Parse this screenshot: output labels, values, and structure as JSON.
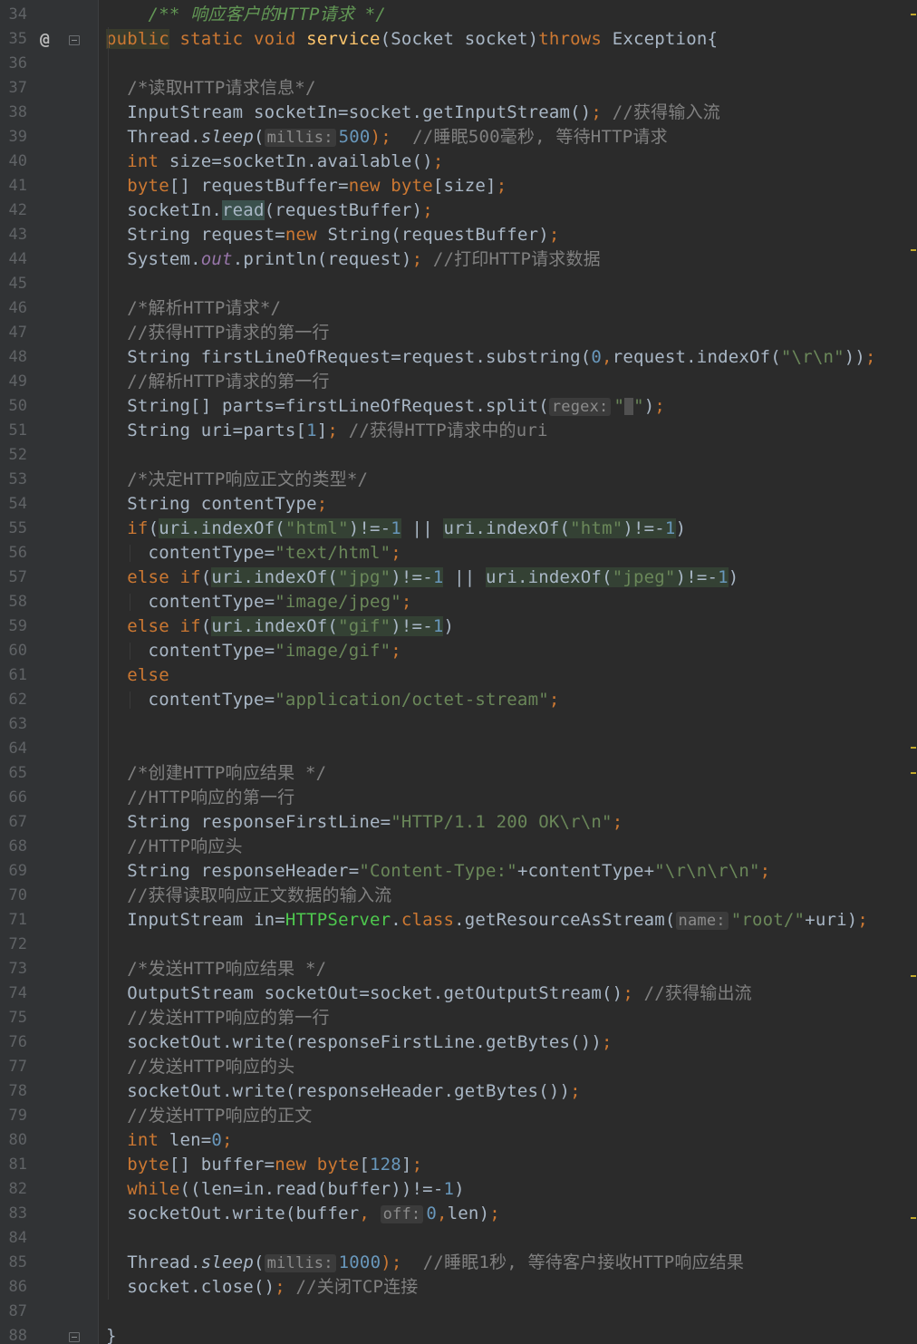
{
  "editor": {
    "gutter_marker": "@",
    "lines": [
      {
        "n": "34",
        "tokens": [
          {
            "t": "    /** ",
            "c": "doc"
          },
          {
            "t": "响应客户的HTTP请求 */",
            "c": "doc"
          }
        ]
      },
      {
        "n": "35",
        "marker": true,
        "fold": true,
        "tokens": [
          {
            "t": "public",
            "c": "kw hl2"
          },
          {
            "t": " static void ",
            "c": "kw"
          },
          {
            "t": "service",
            "c": "fn"
          },
          {
            "t": "(Socket socket)",
            "c": ""
          },
          {
            "t": "throws ",
            "c": "kw"
          },
          {
            "t": "Exception{",
            "c": ""
          }
        ]
      },
      {
        "n": "36",
        "tokens": []
      },
      {
        "n": "37",
        "tokens": [
          {
            "t": "  /*读取HTTP请求信息*/",
            "c": "cm"
          }
        ]
      },
      {
        "n": "38",
        "tokens": [
          {
            "t": "  InputStream socketIn=socket.getInputStream()",
            "c": ""
          },
          {
            "t": "; ",
            "c": "kw"
          },
          {
            "t": "//获得输入流",
            "c": "cm"
          }
        ]
      },
      {
        "n": "39",
        "tokens": [
          {
            "t": "  Thread.",
            "c": ""
          },
          {
            "t": "sleep",
            "c": "ital"
          },
          {
            "t": "(",
            "c": ""
          },
          {
            "t": "millis:",
            "c": "hint"
          },
          {
            "t": "500",
            "c": "num"
          },
          {
            "t": ");",
            "c": "kw"
          },
          {
            "t": "  //睡眠500毫秒, 等待HTTP请求",
            "c": "cm"
          }
        ]
      },
      {
        "n": "40",
        "tokens": [
          {
            "t": "  ",
            "c": ""
          },
          {
            "t": "int ",
            "c": "kw"
          },
          {
            "t": "size=socketIn.available()",
            "c": ""
          },
          {
            "t": ";",
            "c": "kw"
          }
        ]
      },
      {
        "n": "41",
        "tokens": [
          {
            "t": "  ",
            "c": ""
          },
          {
            "t": "byte",
            "c": "kw"
          },
          {
            "t": "[] requestBuffer=",
            "c": ""
          },
          {
            "t": "new ",
            "c": "kw"
          },
          {
            "t": "byte",
            "c": "kw"
          },
          {
            "t": "[size]",
            "c": ""
          },
          {
            "t": ";",
            "c": "kw"
          }
        ]
      },
      {
        "n": "42",
        "tokens": [
          {
            "t": "  socketIn.",
            "c": ""
          },
          {
            "t": "read",
            "c": "read-hl"
          },
          {
            "t": "(requestBuffer)",
            "c": ""
          },
          {
            "t": ";",
            "c": "kw"
          }
        ]
      },
      {
        "n": "43",
        "tokens": [
          {
            "t": "  String request=",
            "c": ""
          },
          {
            "t": "new ",
            "c": "kw"
          },
          {
            "t": "String(requestBuffer)",
            "c": ""
          },
          {
            "t": ";",
            "c": "kw"
          }
        ]
      },
      {
        "n": "44",
        "tokens": [
          {
            "t": "  System.",
            "c": ""
          },
          {
            "t": "out",
            "c": "fld"
          },
          {
            "t": ".println(request)",
            "c": ""
          },
          {
            "t": "; ",
            "c": "kw"
          },
          {
            "t": "//打印HTTP请求数据",
            "c": "cm"
          }
        ]
      },
      {
        "n": "45",
        "tokens": []
      },
      {
        "n": "46",
        "tokens": [
          {
            "t": "  /*解析HTTP请求*/",
            "c": "cm"
          }
        ]
      },
      {
        "n": "47",
        "tokens": [
          {
            "t": "  //获得HTTP请求的第一行",
            "c": "cm"
          }
        ]
      },
      {
        "n": "48",
        "tokens": [
          {
            "t": "  String firstLineOfRequest=request.substring(",
            "c": ""
          },
          {
            "t": "0",
            "c": "num"
          },
          {
            "t": ",",
            "c": "kw"
          },
          {
            "t": "request.indexOf(",
            "c": ""
          },
          {
            "t": "\"\\r\\n\"",
            "c": "str"
          },
          {
            "t": "))",
            "c": ""
          },
          {
            "t": ";",
            "c": "kw"
          }
        ]
      },
      {
        "n": "49",
        "tokens": [
          {
            "t": "  //解析HTTP请求的第一行",
            "c": "cm"
          }
        ]
      },
      {
        "n": "50",
        "tokens": [
          {
            "t": "  String[] parts=firstLineOfRequest.split(",
            "c": ""
          },
          {
            "t": "regex:",
            "c": "hint"
          },
          {
            "t": "\"",
            "c": "str"
          },
          {
            "t": "CARET",
            "c": "caret"
          },
          {
            "t": "\"",
            "c": "str"
          },
          {
            "t": ")",
            "c": ""
          },
          {
            "t": ";",
            "c": "kw"
          }
        ]
      },
      {
        "n": "51",
        "tokens": [
          {
            "t": "  String uri=parts[",
            "c": ""
          },
          {
            "t": "1",
            "c": "num"
          },
          {
            "t": "]",
            "c": ""
          },
          {
            "t": "; ",
            "c": "kw"
          },
          {
            "t": "//获得HTTP请求中的uri",
            "c": "cm"
          }
        ]
      },
      {
        "n": "52",
        "tokens": []
      },
      {
        "n": "53",
        "tokens": [
          {
            "t": "  /*决定HTTP响应正文的类型*/",
            "c": "cm"
          }
        ]
      },
      {
        "n": "54",
        "tokens": [
          {
            "t": "  String contentType",
            "c": ""
          },
          {
            "t": ";",
            "c": "kw"
          }
        ]
      },
      {
        "n": "55",
        "tokens": [
          {
            "t": "  ",
            "c": ""
          },
          {
            "t": "if",
            "c": "kw"
          },
          {
            "t": "(",
            "c": ""
          },
          {
            "t": "uri.indexOf(",
            "c": "hl"
          },
          {
            "t": "\"html\"",
            "c": "str hl"
          },
          {
            "t": ")!=-",
            "c": "hl"
          },
          {
            "t": "1",
            "c": "num hl"
          },
          {
            "t": " || ",
            "c": ""
          },
          {
            "t": "uri.indexOf(",
            "c": "hl"
          },
          {
            "t": "\"htm\"",
            "c": "str hl"
          },
          {
            "t": ")!=-",
            "c": "hl"
          },
          {
            "t": "1",
            "c": "num hl"
          },
          {
            "t": ")",
            "c": ""
          }
        ]
      },
      {
        "n": "56",
        "tokens": [
          {
            "t": "    contentType=",
            "c": ""
          },
          {
            "t": "\"text/html\"",
            "c": "str"
          },
          {
            "t": ";",
            "c": "kw"
          }
        ]
      },
      {
        "n": "57",
        "tokens": [
          {
            "t": "  ",
            "c": ""
          },
          {
            "t": "else if",
            "c": "kw"
          },
          {
            "t": "(",
            "c": ""
          },
          {
            "t": "uri.indexOf(",
            "c": "hl"
          },
          {
            "t": "\"jpg\"",
            "c": "str hl"
          },
          {
            "t": ")!=-",
            "c": "hl"
          },
          {
            "t": "1",
            "c": "num hl"
          },
          {
            "t": " || ",
            "c": ""
          },
          {
            "t": "uri.indexOf(",
            "c": "hl"
          },
          {
            "t": "\"jpeg\"",
            "c": "str hl"
          },
          {
            "t": ")!=-",
            "c": "hl"
          },
          {
            "t": "1",
            "c": "num hl"
          },
          {
            "t": ")",
            "c": ""
          }
        ]
      },
      {
        "n": "58",
        "tokens": [
          {
            "t": "    contentType=",
            "c": ""
          },
          {
            "t": "\"image/jpeg\"",
            "c": "str"
          },
          {
            "t": ";",
            "c": "kw"
          }
        ]
      },
      {
        "n": "59",
        "tokens": [
          {
            "t": "  ",
            "c": ""
          },
          {
            "t": "else if",
            "c": "kw"
          },
          {
            "t": "(",
            "c": ""
          },
          {
            "t": "uri.indexOf(",
            "c": "hl"
          },
          {
            "t": "\"gif\"",
            "c": "str hl"
          },
          {
            "t": ")!=-",
            "c": "hl"
          },
          {
            "t": "1",
            "c": "num hl"
          },
          {
            "t": ")",
            "c": ""
          }
        ]
      },
      {
        "n": "60",
        "tokens": [
          {
            "t": "    contentType=",
            "c": ""
          },
          {
            "t": "\"image/gif\"",
            "c": "str"
          },
          {
            "t": ";",
            "c": "kw"
          }
        ]
      },
      {
        "n": "61",
        "tokens": [
          {
            "t": "  ",
            "c": ""
          },
          {
            "t": "else",
            "c": "kw"
          }
        ]
      },
      {
        "n": "62",
        "tokens": [
          {
            "t": "    contentType=",
            "c": ""
          },
          {
            "t": "\"application/octet-stream\"",
            "c": "str"
          },
          {
            "t": ";",
            "c": "kw"
          }
        ]
      },
      {
        "n": "63",
        "tokens": []
      },
      {
        "n": "64",
        "tokens": []
      },
      {
        "n": "65",
        "tokens": [
          {
            "t": "  /*创建HTTP响应结果 */",
            "c": "cm"
          }
        ]
      },
      {
        "n": "66",
        "tokens": [
          {
            "t": "  //HTTP响应的第一行",
            "c": "cm"
          }
        ]
      },
      {
        "n": "67",
        "tokens": [
          {
            "t": "  String responseFirstLine=",
            "c": ""
          },
          {
            "t": "\"HTTP/1.1 200 OK\\r\\n\"",
            "c": "str"
          },
          {
            "t": ";",
            "c": "kw"
          }
        ]
      },
      {
        "n": "68",
        "tokens": [
          {
            "t": "  //HTTP响应头",
            "c": "cm"
          }
        ]
      },
      {
        "n": "69",
        "tokens": [
          {
            "t": "  String responseHeader=",
            "c": ""
          },
          {
            "t": "\"Content-Type:\"",
            "c": "str"
          },
          {
            "t": "+contentType+",
            "c": ""
          },
          {
            "t": "\"\\r\\n\\r\\n\"",
            "c": "str"
          },
          {
            "t": ";",
            "c": "kw"
          }
        ]
      },
      {
        "n": "70",
        "tokens": [
          {
            "t": "  //获得读取响应正文数据的输入流",
            "c": "cm"
          }
        ]
      },
      {
        "n": "71",
        "tokens": [
          {
            "t": "  InputStream in=",
            "c": ""
          },
          {
            "t": "HTTPServer",
            "c": "green"
          },
          {
            "t": ".",
            "c": ""
          },
          {
            "t": "class",
            "c": "kw"
          },
          {
            "t": ".getResourceAsStream(",
            "c": ""
          },
          {
            "t": "name:",
            "c": "hint"
          },
          {
            "t": "\"root/\"",
            "c": "str"
          },
          {
            "t": "+uri)",
            "c": ""
          },
          {
            "t": ";",
            "c": "kw"
          }
        ]
      },
      {
        "n": "72",
        "tokens": []
      },
      {
        "n": "73",
        "tokens": [
          {
            "t": "  /*发送HTTP响应结果 */",
            "c": "cm"
          }
        ]
      },
      {
        "n": "74",
        "tokens": [
          {
            "t": "  OutputStream socketOut=socket.getOutputStream()",
            "c": ""
          },
          {
            "t": "; ",
            "c": "kw"
          },
          {
            "t": "//获得输出流",
            "c": "cm"
          }
        ]
      },
      {
        "n": "75",
        "tokens": [
          {
            "t": "  //发送HTTP响应的第一行",
            "c": "cm"
          }
        ]
      },
      {
        "n": "76",
        "tokens": [
          {
            "t": "  socketOut.write(responseFirstLine.getBytes())",
            "c": ""
          },
          {
            "t": ";",
            "c": "kw"
          }
        ]
      },
      {
        "n": "77",
        "tokens": [
          {
            "t": "  //发送HTTP响应的头",
            "c": "cm"
          }
        ]
      },
      {
        "n": "78",
        "tokens": [
          {
            "t": "  socketOut.write(responseHeader.getBytes())",
            "c": ""
          },
          {
            "t": ";",
            "c": "kw"
          }
        ]
      },
      {
        "n": "79",
        "tokens": [
          {
            "t": "  //发送HTTP响应的正文",
            "c": "cm"
          }
        ]
      },
      {
        "n": "80",
        "tokens": [
          {
            "t": "  ",
            "c": ""
          },
          {
            "t": "int ",
            "c": "kw"
          },
          {
            "t": "len=",
            "c": ""
          },
          {
            "t": "0",
            "c": "num"
          },
          {
            "t": ";",
            "c": "kw"
          }
        ]
      },
      {
        "n": "81",
        "tokens": [
          {
            "t": "  ",
            "c": ""
          },
          {
            "t": "byte",
            "c": "kw"
          },
          {
            "t": "[] buffer=",
            "c": ""
          },
          {
            "t": "new ",
            "c": "kw"
          },
          {
            "t": "byte",
            "c": "kw"
          },
          {
            "t": "[",
            "c": ""
          },
          {
            "t": "128",
            "c": "num"
          },
          {
            "t": "]",
            "c": ""
          },
          {
            "t": ";",
            "c": "kw"
          }
        ]
      },
      {
        "n": "82",
        "tokens": [
          {
            "t": "  ",
            "c": ""
          },
          {
            "t": "while",
            "c": "kw"
          },
          {
            "t": "((len=in.read(buffer))!=-",
            "c": ""
          },
          {
            "t": "1",
            "c": "num"
          },
          {
            "t": ")",
            "c": ""
          }
        ]
      },
      {
        "n": "83",
        "tokens": [
          {
            "t": "  socketOut.write(buffer",
            "c": ""
          },
          {
            "t": ", ",
            "c": "kw"
          },
          {
            "t": "off:",
            "c": "hint"
          },
          {
            "t": "0",
            "c": "num"
          },
          {
            "t": ",",
            "c": "kw"
          },
          {
            "t": "len)",
            "c": ""
          },
          {
            "t": ";",
            "c": "kw"
          }
        ]
      },
      {
        "n": "84",
        "tokens": []
      },
      {
        "n": "85",
        "tokens": [
          {
            "t": "  Thread.",
            "c": ""
          },
          {
            "t": "sleep",
            "c": "ital"
          },
          {
            "t": "(",
            "c": ""
          },
          {
            "t": "millis:",
            "c": "hint"
          },
          {
            "t": "1000",
            "c": "num"
          },
          {
            "t": ");",
            "c": "kw"
          },
          {
            "t": "  //睡眠1秒, 等待客户接收HTTP响应结果",
            "c": "cm"
          }
        ]
      },
      {
        "n": "86",
        "tokens": [
          {
            "t": "  socket.close()",
            "c": ""
          },
          {
            "t": "; ",
            "c": "kw"
          },
          {
            "t": "//关闭TCP连接",
            "c": "cm"
          }
        ]
      },
      {
        "n": "87",
        "tokens": []
      },
      {
        "n": "88",
        "fold": true,
        "tokens": [
          {
            "t": "}",
            "c": ""
          }
        ]
      }
    ]
  },
  "colors": {
    "background": "#2b2b2b",
    "gutter": "#313335",
    "keyword": "#cc7832",
    "string": "#6a8759",
    "number": "#6897bb",
    "comment": "#808080",
    "method": "#ffc66d",
    "scroll_marker": "#c2a82b"
  }
}
